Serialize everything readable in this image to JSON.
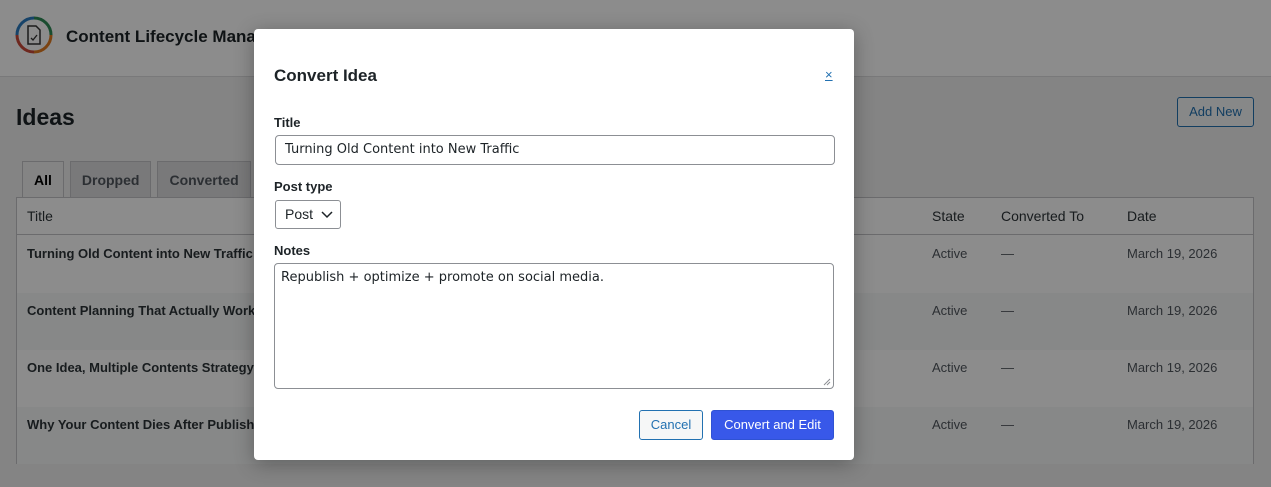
{
  "header": {
    "app_title": "Content Lifecycle Manag",
    "logo_icon": "document-cycle-icon"
  },
  "page": {
    "title": "Ideas",
    "add_new_label": "Add New"
  },
  "tabs": [
    {
      "label": "All",
      "active": true
    },
    {
      "label": "Dropped",
      "active": false
    },
    {
      "label": "Converted",
      "active": false
    }
  ],
  "table": {
    "columns": [
      "Title",
      "State",
      "Converted To",
      "Date"
    ],
    "rows": [
      {
        "title": "Turning Old Content into New Traffic",
        "state": "Active",
        "converted_to": "—",
        "date": "March 19, 2026"
      },
      {
        "title": "Content Planning That Actually Works",
        "state": "Active",
        "converted_to": "—",
        "date": "March 19, 2026"
      },
      {
        "title": "One Idea, Multiple Contents Strategy",
        "state": "Active",
        "converted_to": "—",
        "date": "March 19, 2026"
      },
      {
        "title": "Why Your Content Dies After Publishing",
        "state": "Active",
        "converted_to": "—",
        "date": "March 19, 2026"
      }
    ]
  },
  "modal": {
    "title": "Convert Idea",
    "close_label": "×",
    "title_label": "Title",
    "title_value": "Turning Old Content into New Traffic",
    "post_type_label": "Post type",
    "post_type_value": "Post",
    "notes_label": "Notes",
    "notes_value": "Republish + optimize + promote on social media.",
    "cancel_label": "Cancel",
    "submit_label": "Convert and Edit"
  },
  "colors": {
    "primary": "#3858e9",
    "link": "#2271b1"
  }
}
